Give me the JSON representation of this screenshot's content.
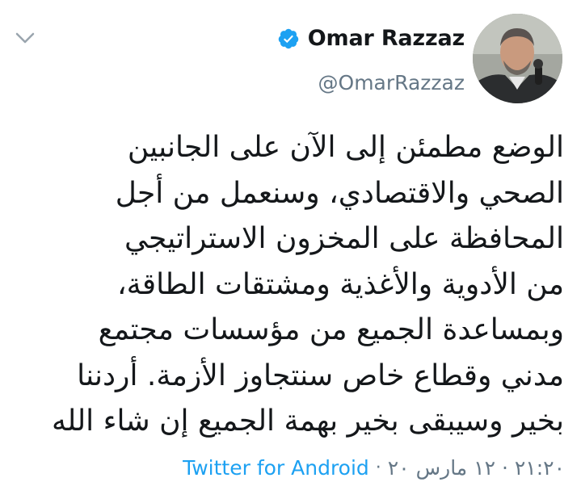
{
  "author": {
    "display_name": "Omar Razzaz",
    "handle": "@OmarRazzaz",
    "verified": true,
    "avatar_icon": "profile-photo"
  },
  "tweet": {
    "lines": [
      "الوضع مطمئن إلى الآن على الجانبين",
      "الصحي والاقتصادي، وسنعمل من أجل",
      "المحافظة على المخزون الاستراتيجي",
      "من الأدوية والأغذية ومشتقات الطاقة،",
      "وبمساعدة الجميع من مؤسسات مجتمع",
      "مدني وقطاع خاص سنتجاوز الأزمة. أردننا",
      "بخير وسيبقى بخير بهمة الجميع إن شاء الله"
    ]
  },
  "meta": {
    "timestamp": "٢١:٢٠ · ١٢ مارس ٢٠",
    "separator": "·",
    "source": "Twitter for Android"
  },
  "colors": {
    "accent": "#1da1f2",
    "text": "#14171a",
    "secondary": "#657786"
  },
  "icons": {
    "verified": "verified-badge-icon",
    "menu": "chevron-down-icon"
  }
}
